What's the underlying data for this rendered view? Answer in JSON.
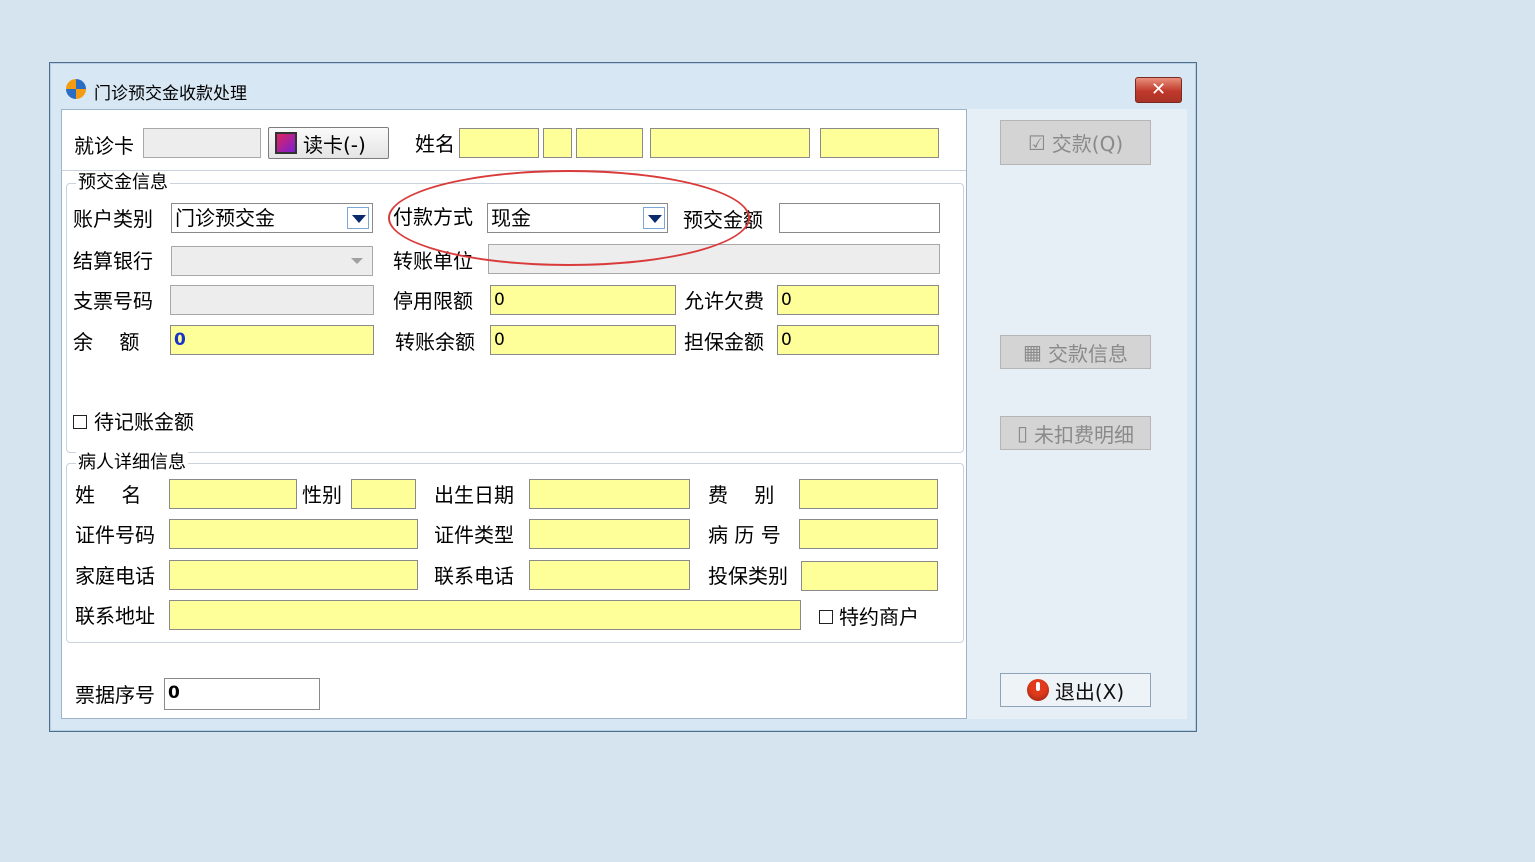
{
  "window": {
    "title": "门诊预交金收款处理",
    "close_symbol": "✕"
  },
  "top_row": {
    "card_label": "就诊卡",
    "card_value": "",
    "read_card_button": "读卡(-)",
    "name_label": "姓名"
  },
  "prepay_group": {
    "title": "预交金信息",
    "account_type_label": "账户类别",
    "account_type_value": "门诊预交金",
    "payment_method_label": "付款方式",
    "payment_method_value": "现金",
    "prepay_amount_label": "预交金额",
    "prepay_amount_value": "",
    "bank_label": "结算银行",
    "bank_value": "",
    "transfer_unit_label": "转账单位",
    "transfer_unit_value": "",
    "check_no_label": "支票号码",
    "check_no_value": "",
    "stop_limit_label": "停用限额",
    "stop_limit_value": "0",
    "allow_debt_label": "允许欠费",
    "allow_debt_value": "0",
    "balance_label": "余　 额",
    "balance_value": "0",
    "transfer_balance_label": "转账余额",
    "transfer_balance_value": "0",
    "guarantee_label": "担保金额",
    "guarantee_value": "0",
    "pending_label": "待记账金额"
  },
  "patient_group": {
    "title": "病人详细信息",
    "name_label": "姓　 名",
    "gender_label": "性别",
    "birth_label": "出生日期",
    "fee_type_label": "费　 别",
    "id_no_label": "证件号码",
    "id_type_label": "证件类型",
    "record_no_label": "病 历 号",
    "home_phone_label": "家庭电话",
    "contact_phone_label": "联系电话",
    "insurance_label": "投保类别",
    "address_label": "联系地址",
    "special_merchant_label": "特约商户"
  },
  "receipt": {
    "label": "票据序号",
    "value": "0"
  },
  "buttons": {
    "pay": "交款(Q)",
    "pay_info": "交款信息",
    "unpaid_detail": "未扣费明细",
    "exit": "退出(X)"
  },
  "colors": {
    "input_yellow": "#ffff99",
    "annotation_red": "#d93a3a",
    "balance_blue": "#1b33c7"
  },
  "icons": {
    "app": "app-logo-icon",
    "card_reader": "card-reader-icon",
    "check": "checkmark-icon",
    "info": "calculator-icon",
    "detail": "clipboard-icon",
    "power": "power-icon"
  }
}
